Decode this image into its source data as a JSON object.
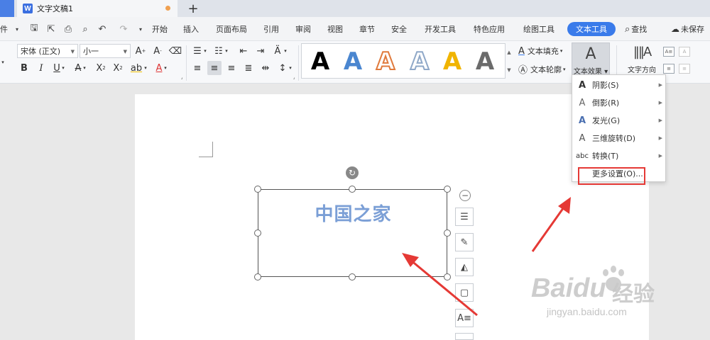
{
  "tabbar": {
    "app_badge": "W",
    "doc_title": "文字文稿1",
    "new_tab": "+"
  },
  "menubar": {
    "file_partial": "件",
    "start": "开始",
    "insert": "插入",
    "layout": "页面布局",
    "references": "引用",
    "review": "审阅",
    "view": "视图",
    "chapter": "章节",
    "security": "安全",
    "dev_tools": "开发工具",
    "special": "特色应用",
    "drawing_tools": "绘图工具",
    "text_tools": "文本工具",
    "search": "查找",
    "unsaved": "未保存"
  },
  "ribbon": {
    "font_name": "宋体 (正文)",
    "font_size": "小一",
    "text_fill": "文本填充",
    "text_outline": "文本轮廓",
    "text_effect": "文本效果",
    "text_direction": "文字方向",
    "gallery_letter": "A",
    "gallery_colors": [
      "#000000",
      "#4a86d0",
      "#e07a3c",
      "#8fa8c8",
      "#f0b400",
      "#6b6b6b"
    ]
  },
  "document": {
    "textbox_text": "中国之家"
  },
  "dropdown": {
    "items": [
      {
        "icon": "A",
        "label": "阴影(S)"
      },
      {
        "icon": "A",
        "label": "倒影(R)"
      },
      {
        "icon": "A",
        "label": "发光(G)"
      },
      {
        "icon": "A",
        "label": "三维旋转(D)"
      },
      {
        "icon": "abc",
        "label": "转换(T)"
      }
    ],
    "more": "更多设置(O)..."
  },
  "watermark": {
    "logo": "Baidu",
    "cn": "经验",
    "url": "jingyan.baidu.com"
  },
  "colors": {
    "accent": "#3a7bea",
    "annotation_red": "#e53935",
    "textbox_text": "#7b9fd6"
  }
}
